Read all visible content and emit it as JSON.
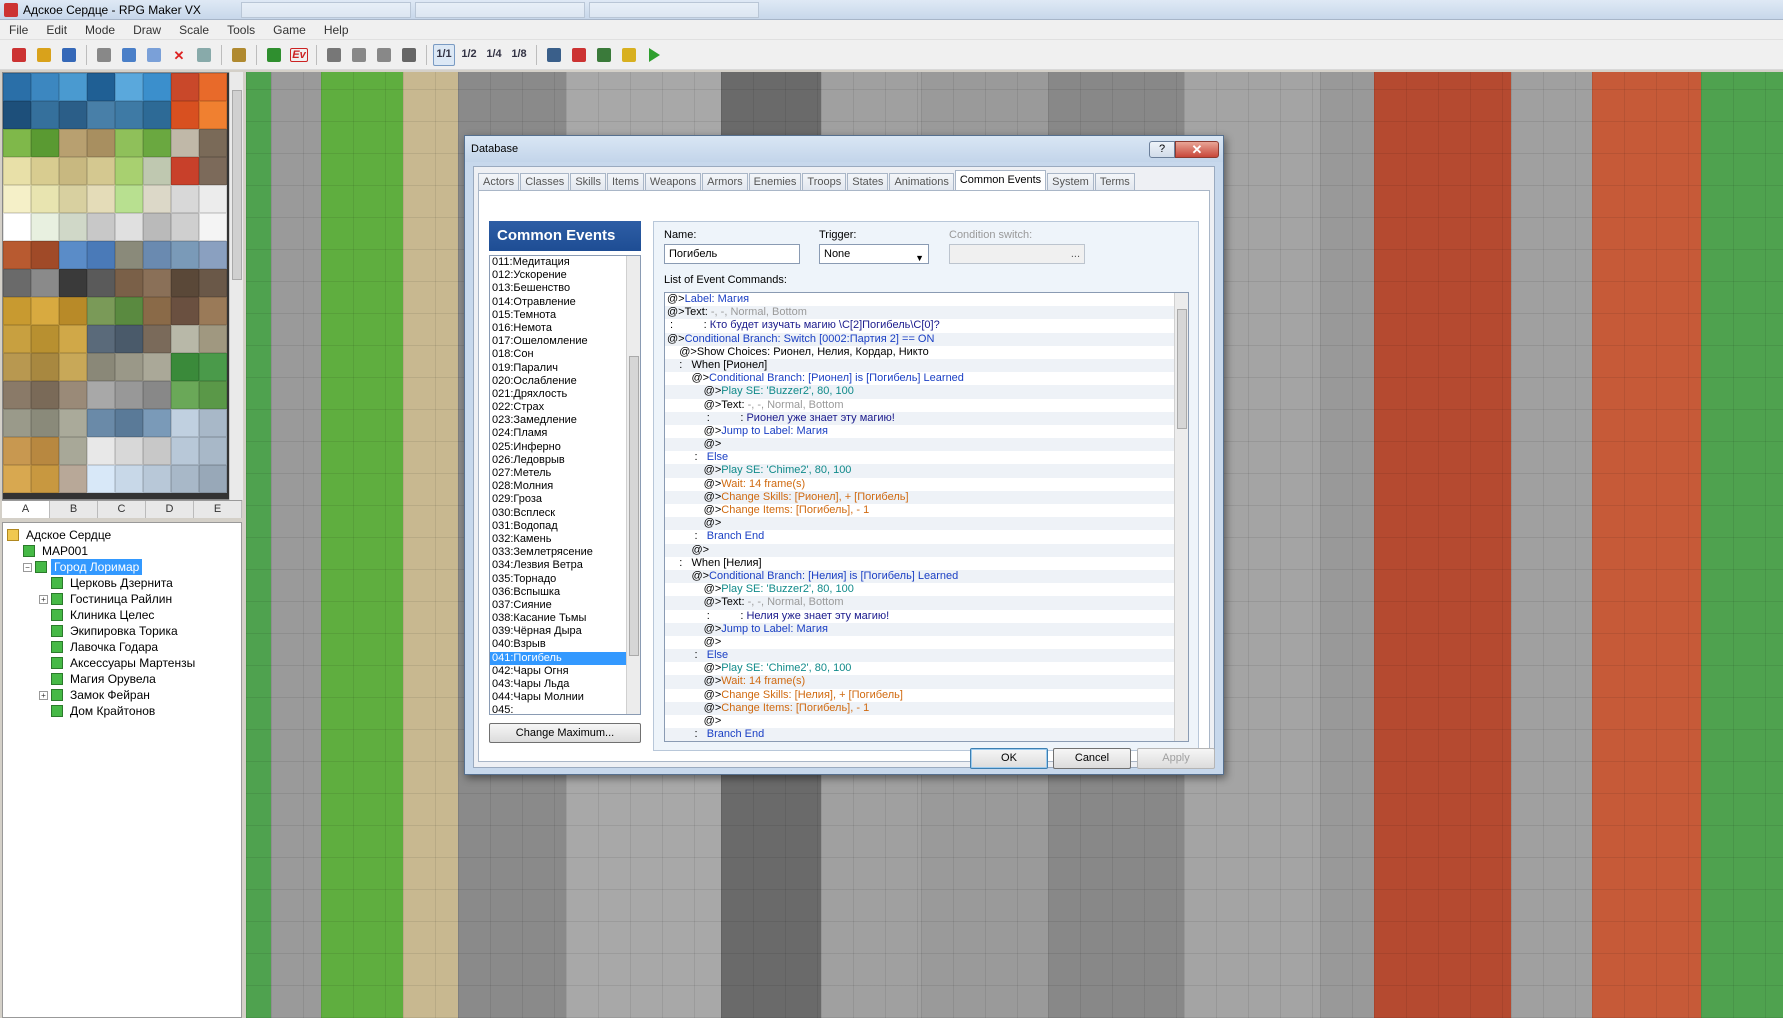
{
  "window": {
    "title": "Адское Сердце - RPG Maker VX"
  },
  "menu": [
    "File",
    "Edit",
    "Mode",
    "Draw",
    "Scale",
    "Tools",
    "Game",
    "Help"
  ],
  "toolbar": {
    "icons": [
      "new-project-icon",
      "open-project-icon",
      "save-icon",
      "cut-icon",
      "copy-icon",
      "paste-icon",
      "delete-icon",
      "undo-icon",
      "character-icon",
      "map-mode-icon",
      "event-mode-icon",
      "pencil-icon",
      "rectangle-icon",
      "ellipse-icon",
      "fill-icon",
      "scale-1-1-icon",
      "scale-1-2-icon",
      "scale-1-4-icon",
      "scale-1-8-icon",
      "database-icon",
      "materials-icon",
      "script-editor-icon",
      "sound-test-icon",
      "playtest-icon"
    ],
    "scale_labels": [
      "1/1",
      "1/2",
      "1/4",
      "1/8"
    ],
    "event_label": "Ev"
  },
  "palette": {
    "tabs": [
      "A",
      "B",
      "C",
      "D",
      "E"
    ],
    "active_tab": "A"
  },
  "map_tree": [
    {
      "label": "Адское Сердце",
      "level": 0,
      "type": "folder",
      "expander": ""
    },
    {
      "label": "MAP001",
      "level": 1,
      "type": "map",
      "expander": ""
    },
    {
      "label": "Город Лоримар",
      "level": 1,
      "type": "map",
      "expander": "−",
      "selected": true
    },
    {
      "label": "Церковь Дзернита",
      "level": 2,
      "type": "map",
      "expander": ""
    },
    {
      "label": "Гостиница Райлин",
      "level": 2,
      "type": "map",
      "expander": "+"
    },
    {
      "label": "Клиника Целес",
      "level": 2,
      "type": "map",
      "expander": ""
    },
    {
      "label": "Экипировка Торика",
      "level": 2,
      "type": "map",
      "expander": ""
    },
    {
      "label": "Лавочка Годара",
      "level": 2,
      "type": "map",
      "expander": ""
    },
    {
      "label": "Аксессуары Мартензы",
      "level": 2,
      "type": "map",
      "expander": ""
    },
    {
      "label": "Магия Орувела",
      "level": 2,
      "type": "map",
      "expander": ""
    },
    {
      "label": "Замок Фейран",
      "level": 2,
      "type": "map",
      "expander": "+"
    },
    {
      "label": "Дом Крайтонов",
      "level": 2,
      "type": "map",
      "expander": ""
    }
  ],
  "dialog": {
    "title": "Database",
    "help": "?",
    "close": "✕",
    "tabs": [
      "Actors",
      "Classes",
      "Skills",
      "Items",
      "Weapons",
      "Armors",
      "Enemies",
      "Troops",
      "States",
      "Animations",
      "Common Events",
      "System",
      "Terms"
    ],
    "active_tab": "Common Events",
    "list_header": "Common Events",
    "events": [
      "011:Медитация",
      "012:Ускорение",
      "013:Бешенство",
      "014:Отравление",
      "015:Темнота",
      "016:Немота",
      "017:Ошеломление",
      "018:Сон",
      "019:Паралич",
      "020:Ослабление",
      "021:Дряхлость",
      "022:Страх",
      "023:Замедление",
      "024:Пламя",
      "025:Инферно",
      "026:Ледоврыв",
      "027:Метель",
      "028:Молния",
      "029:Гроза",
      "030:Всплеск",
      "031:Водопад",
      "032:Камень",
      "033:Землетрясение",
      "034:Лезвия Ветра",
      "035:Торнадо",
      "036:Вспышка",
      "037:Сияние",
      "038:Касание Тьмы",
      "039:Чёрная Дыра",
      "040:Взрыв",
      "041:Погибель",
      "042:Чары Огня",
      "043:Чары Льда",
      "044:Чары Молнии",
      "045:"
    ],
    "selected_event": "041:Погибель",
    "change_max_label": "Change Maximum...",
    "name_label": "Name:",
    "name_value": "Погибель",
    "trigger_label": "Trigger:",
    "trigger_value": "None",
    "condition_label": "Condition switch:",
    "condition_button": "...",
    "commands_label": "List of Event Commands:",
    "commands": [
      {
        "prefix": "@>",
        "text": "Label: Магия",
        "cls": "c-flow"
      },
      {
        "prefix": "@>",
        "text": "Text: ",
        "cls": "",
        "extra": "-, -, Normal, Bottom",
        "extra_cls": "c-grey"
      },
      {
        "prefix": " :          : ",
        "text": "Кто будет изучать магию \\C[2]Погибель\\C[0]?",
        "cls": "c-text"
      },
      {
        "prefix": "@>",
        "text": "Conditional Branch: Switch [0002:Партия 2] == ON",
        "cls": "c-flow"
      },
      {
        "prefix": "    @>",
        "text": "Show Choices: Рионел, Нелия, Кордар, Никто",
        "cls": ""
      },
      {
        "prefix": "    :   ",
        "text": "When [Рионел]",
        "cls": ""
      },
      {
        "prefix": "        @>",
        "text": "Conditional Branch: [Рионел] is [Погибель] Learned",
        "cls": "c-flow"
      },
      {
        "prefix": "            @>",
        "text": "Play SE: 'Buzzer2', 80, 100",
        "cls": "c-se"
      },
      {
        "prefix": "            @>",
        "text": "Text: ",
        "cls": "",
        "extra": "-, -, Normal, Bottom",
        "extra_cls": "c-grey"
      },
      {
        "prefix": "             :          : ",
        "text": "Рионел уже знает эту магию!",
        "cls": "c-text"
      },
      {
        "prefix": "            @>",
        "text": "Jump to Label: Магия",
        "cls": "c-flow"
      },
      {
        "prefix": "            @>",
        "text": "",
        "cls": ""
      },
      {
        "prefix": "         :   ",
        "text": "Else",
        "cls": "c-flow"
      },
      {
        "prefix": "            @>",
        "text": "Play SE: 'Chime2', 80, 100",
        "cls": "c-se"
      },
      {
        "prefix": "            @>",
        "text": "Wait: 14 frame(s)",
        "cls": "c-orange"
      },
      {
        "prefix": "            @>",
        "text": "Change Skills: [Рионел], + [Погибель]",
        "cls": "c-orange"
      },
      {
        "prefix": "            @>",
        "text": "Change Items: [Погибель], - 1",
        "cls": "c-orange"
      },
      {
        "prefix": "            @>",
        "text": "",
        "cls": ""
      },
      {
        "prefix": "         :   ",
        "text": "Branch End",
        "cls": "c-flow"
      },
      {
        "prefix": "        @>",
        "text": "",
        "cls": ""
      },
      {
        "prefix": "    :   ",
        "text": "When [Нелия]",
        "cls": ""
      },
      {
        "prefix": "        @>",
        "text": "Conditional Branch: [Нелия] is [Погибель] Learned",
        "cls": "c-flow"
      },
      {
        "prefix": "            @>",
        "text": "Play SE: 'Buzzer2', 80, 100",
        "cls": "c-se"
      },
      {
        "prefix": "            @>",
        "text": "Text: ",
        "cls": "",
        "extra": "-, -, Normal, Bottom",
        "extra_cls": "c-grey"
      },
      {
        "prefix": "             :          : ",
        "text": "Нелия уже знает эту магию!",
        "cls": "c-text"
      },
      {
        "prefix": "            @>",
        "text": "Jump to Label: Магия",
        "cls": "c-flow"
      },
      {
        "prefix": "            @>",
        "text": "",
        "cls": ""
      },
      {
        "prefix": "         :   ",
        "text": "Else",
        "cls": "c-flow"
      },
      {
        "prefix": "            @>",
        "text": "Play SE: 'Chime2', 80, 100",
        "cls": "c-se"
      },
      {
        "prefix": "            @>",
        "text": "Wait: 14 frame(s)",
        "cls": "c-orange"
      },
      {
        "prefix": "            @>",
        "text": "Change Skills: [Нелия], + [Погибель]",
        "cls": "c-orange"
      },
      {
        "prefix": "            @>",
        "text": "Change Items: [Погибель], - 1",
        "cls": "c-orange"
      },
      {
        "prefix": "            @>",
        "text": "",
        "cls": ""
      },
      {
        "prefix": "         :   ",
        "text": "Branch End",
        "cls": "c-flow"
      }
    ],
    "ok_label": "OK",
    "cancel_label": "Cancel",
    "apply_label": "Apply"
  },
  "colors": {
    "selection": "#3399ff",
    "list_header": "#1e4d94",
    "flow_command": "#1a3fc4",
    "se_command": "#108a8a",
    "change_command": "#d06a10"
  }
}
